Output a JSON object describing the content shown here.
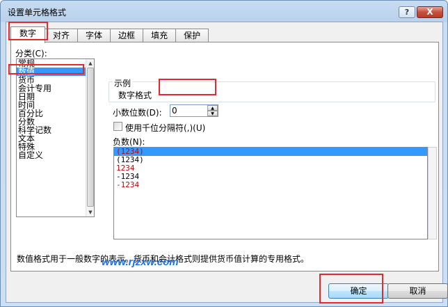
{
  "window": {
    "title": "设置单元格格式",
    "help_label": "?",
    "close_label": "X"
  },
  "tabs": [
    {
      "label": "数字"
    },
    {
      "label": "对齐"
    },
    {
      "label": "字体"
    },
    {
      "label": "边框"
    },
    {
      "label": "填充"
    },
    {
      "label": "保护"
    }
  ],
  "category": {
    "label": "分类(C):",
    "items": [
      "常规",
      "数值",
      "货币",
      "会计专用",
      "日期",
      "时间",
      "百分比",
      "分数",
      "科学记数",
      "文本",
      "特殊",
      "自定义"
    ],
    "selected": "数值"
  },
  "sample": {
    "label": "示例",
    "value": "数字格式"
  },
  "decimal": {
    "label": "小数位数(D):",
    "value": "0"
  },
  "thousands": {
    "label": "使用千位分隔符(,)(U)",
    "checked": false
  },
  "negative": {
    "label": "负数(N):",
    "items": [
      {
        "text": "(1234)",
        "color": "#cc0000",
        "selected": true
      },
      {
        "text": "(1234)",
        "color": "#000000"
      },
      {
        "text": "1234",
        "color": "#cc0000"
      },
      {
        "text": "-1234",
        "color": "#000000"
      },
      {
        "text": "-1234",
        "color": "#cc0000"
      }
    ]
  },
  "description": "数值格式用于一般数字的表示。货币和会计格式则提供货币值计算的专用格式。",
  "watermark": "www.rjzxw.com",
  "buttons": {
    "ok": "确定",
    "cancel": "取消"
  },
  "colors": {
    "selection": "#3399ff",
    "highlight": "#e8262d",
    "watermark": "#1e6ff0"
  }
}
